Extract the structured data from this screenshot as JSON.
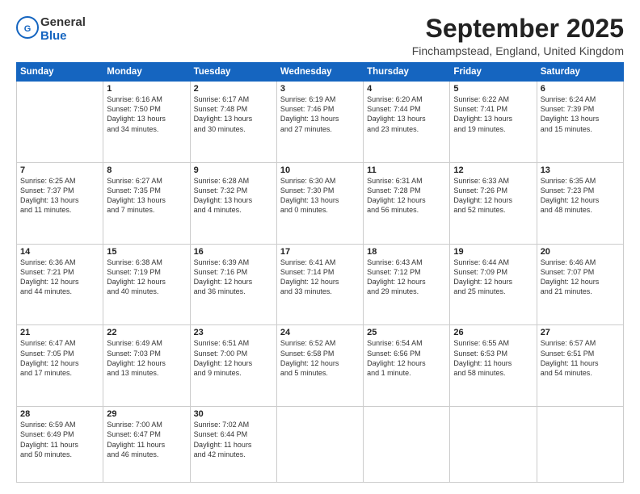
{
  "header": {
    "logo_general": "General",
    "logo_blue": "Blue",
    "month": "September 2025",
    "location": "Finchampstead, England, United Kingdom"
  },
  "weekdays": [
    "Sunday",
    "Monday",
    "Tuesday",
    "Wednesday",
    "Thursday",
    "Friday",
    "Saturday"
  ],
  "weeks": [
    [
      {
        "day": "",
        "info": ""
      },
      {
        "day": "1",
        "info": "Sunrise: 6:16 AM\nSunset: 7:50 PM\nDaylight: 13 hours\nand 34 minutes."
      },
      {
        "day": "2",
        "info": "Sunrise: 6:17 AM\nSunset: 7:48 PM\nDaylight: 13 hours\nand 30 minutes."
      },
      {
        "day": "3",
        "info": "Sunrise: 6:19 AM\nSunset: 7:46 PM\nDaylight: 13 hours\nand 27 minutes."
      },
      {
        "day": "4",
        "info": "Sunrise: 6:20 AM\nSunset: 7:44 PM\nDaylight: 13 hours\nand 23 minutes."
      },
      {
        "day": "5",
        "info": "Sunrise: 6:22 AM\nSunset: 7:41 PM\nDaylight: 13 hours\nand 19 minutes."
      },
      {
        "day": "6",
        "info": "Sunrise: 6:24 AM\nSunset: 7:39 PM\nDaylight: 13 hours\nand 15 minutes."
      }
    ],
    [
      {
        "day": "7",
        "info": "Sunrise: 6:25 AM\nSunset: 7:37 PM\nDaylight: 13 hours\nand 11 minutes."
      },
      {
        "day": "8",
        "info": "Sunrise: 6:27 AM\nSunset: 7:35 PM\nDaylight: 13 hours\nand 7 minutes."
      },
      {
        "day": "9",
        "info": "Sunrise: 6:28 AM\nSunset: 7:32 PM\nDaylight: 13 hours\nand 4 minutes."
      },
      {
        "day": "10",
        "info": "Sunrise: 6:30 AM\nSunset: 7:30 PM\nDaylight: 13 hours\nand 0 minutes."
      },
      {
        "day": "11",
        "info": "Sunrise: 6:31 AM\nSunset: 7:28 PM\nDaylight: 12 hours\nand 56 minutes."
      },
      {
        "day": "12",
        "info": "Sunrise: 6:33 AM\nSunset: 7:26 PM\nDaylight: 12 hours\nand 52 minutes."
      },
      {
        "day": "13",
        "info": "Sunrise: 6:35 AM\nSunset: 7:23 PM\nDaylight: 12 hours\nand 48 minutes."
      }
    ],
    [
      {
        "day": "14",
        "info": "Sunrise: 6:36 AM\nSunset: 7:21 PM\nDaylight: 12 hours\nand 44 minutes."
      },
      {
        "day": "15",
        "info": "Sunrise: 6:38 AM\nSunset: 7:19 PM\nDaylight: 12 hours\nand 40 minutes."
      },
      {
        "day": "16",
        "info": "Sunrise: 6:39 AM\nSunset: 7:16 PM\nDaylight: 12 hours\nand 36 minutes."
      },
      {
        "day": "17",
        "info": "Sunrise: 6:41 AM\nSunset: 7:14 PM\nDaylight: 12 hours\nand 33 minutes."
      },
      {
        "day": "18",
        "info": "Sunrise: 6:43 AM\nSunset: 7:12 PM\nDaylight: 12 hours\nand 29 minutes."
      },
      {
        "day": "19",
        "info": "Sunrise: 6:44 AM\nSunset: 7:09 PM\nDaylight: 12 hours\nand 25 minutes."
      },
      {
        "day": "20",
        "info": "Sunrise: 6:46 AM\nSunset: 7:07 PM\nDaylight: 12 hours\nand 21 minutes."
      }
    ],
    [
      {
        "day": "21",
        "info": "Sunrise: 6:47 AM\nSunset: 7:05 PM\nDaylight: 12 hours\nand 17 minutes."
      },
      {
        "day": "22",
        "info": "Sunrise: 6:49 AM\nSunset: 7:03 PM\nDaylight: 12 hours\nand 13 minutes."
      },
      {
        "day": "23",
        "info": "Sunrise: 6:51 AM\nSunset: 7:00 PM\nDaylight: 12 hours\nand 9 minutes."
      },
      {
        "day": "24",
        "info": "Sunrise: 6:52 AM\nSunset: 6:58 PM\nDaylight: 12 hours\nand 5 minutes."
      },
      {
        "day": "25",
        "info": "Sunrise: 6:54 AM\nSunset: 6:56 PM\nDaylight: 12 hours\nand 1 minute."
      },
      {
        "day": "26",
        "info": "Sunrise: 6:55 AM\nSunset: 6:53 PM\nDaylight: 11 hours\nand 58 minutes."
      },
      {
        "day": "27",
        "info": "Sunrise: 6:57 AM\nSunset: 6:51 PM\nDaylight: 11 hours\nand 54 minutes."
      }
    ],
    [
      {
        "day": "28",
        "info": "Sunrise: 6:59 AM\nSunset: 6:49 PM\nDaylight: 11 hours\nand 50 minutes."
      },
      {
        "day": "29",
        "info": "Sunrise: 7:00 AM\nSunset: 6:47 PM\nDaylight: 11 hours\nand 46 minutes."
      },
      {
        "day": "30",
        "info": "Sunrise: 7:02 AM\nSunset: 6:44 PM\nDaylight: 11 hours\nand 42 minutes."
      },
      {
        "day": "",
        "info": ""
      },
      {
        "day": "",
        "info": ""
      },
      {
        "day": "",
        "info": ""
      },
      {
        "day": "",
        "info": ""
      }
    ]
  ]
}
